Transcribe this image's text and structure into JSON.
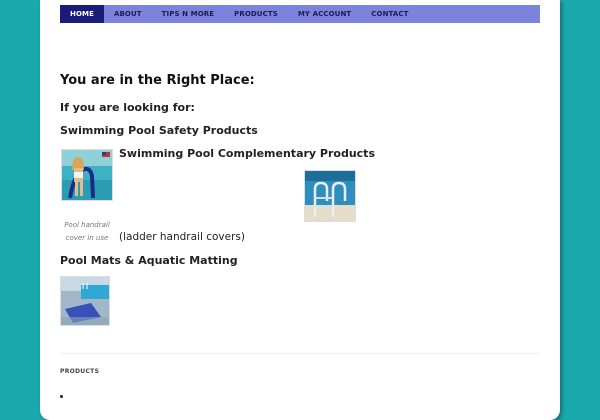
{
  "nav": {
    "items": [
      {
        "label": "HOME",
        "active": true
      },
      {
        "label": "ABOUT",
        "active": false
      },
      {
        "label": "TIPS N MORE",
        "active": false
      },
      {
        "label": "PRODUCTS",
        "active": false
      },
      {
        "label": "MY ACCOUNT",
        "active": false
      },
      {
        "label": "CONTACT",
        "active": false
      }
    ]
  },
  "content": {
    "heading": "You are in the Right Place:",
    "looking_for": "If you are looking for:",
    "safety_heading": "Swimming Pool Safety Products",
    "complementary_heading": "Swimming Pool Complementary Products",
    "handrail_caption": "Pool handrail cover in use",
    "handrail_note": "(ladder handrail covers)",
    "mats_heading": "Pool Mats & Aquatic Matting"
  },
  "footer": {
    "title": "PRODUCTS"
  },
  "colors": {
    "background": "#1aa9ad",
    "nav": "#7b83dc",
    "nav_active": "#1a1c7a"
  }
}
